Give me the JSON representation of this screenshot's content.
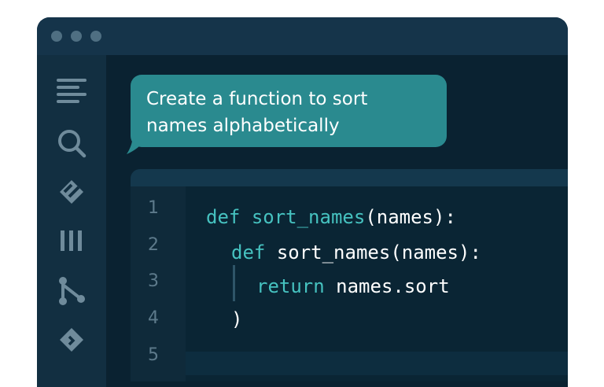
{
  "window": {
    "traffic_lights": [
      "dot",
      "dot",
      "dot"
    ]
  },
  "sidebar": {
    "items": [
      {
        "icon": "explorer-lines-icon"
      },
      {
        "icon": "search-icon"
      },
      {
        "icon": "source-control-diamond-icon"
      },
      {
        "icon": "columns-icon"
      },
      {
        "icon": "git-branch-icon"
      },
      {
        "icon": "extension-diamond-icon"
      }
    ]
  },
  "prompt": {
    "line1": "Create a function to sort",
    "line2": "names alphabetically"
  },
  "editor": {
    "line_numbers": [
      "1",
      "2",
      "3",
      "4",
      "5"
    ],
    "lines": [
      {
        "kw": "def",
        "name": "sort_names",
        "rest": "(names):"
      },
      {
        "kw": "def",
        "name": "sort_names",
        "rest": "(names):"
      },
      {
        "kw": "return",
        "rest": "names.sort"
      },
      {
        "rest": ")"
      }
    ]
  },
  "colors": {
    "accent": "#2a8a8f",
    "keyword": "#46c2c0",
    "background": "#0a2231"
  }
}
